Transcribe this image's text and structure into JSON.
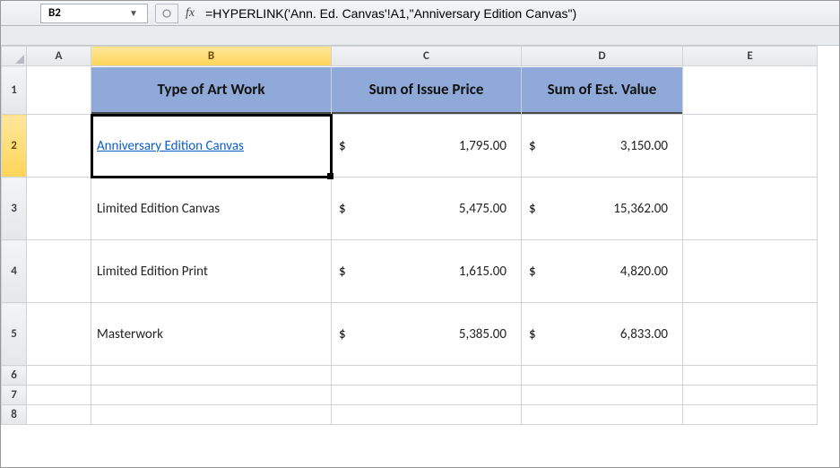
{
  "name_box": {
    "value": "B2"
  },
  "fx_label": "fx",
  "formula": "=HYPERLINK('Ann. Ed. Canvas'!A1,\"Anniversary Edition Canvas\")",
  "columns": [
    "A",
    "B",
    "C",
    "D",
    "E"
  ],
  "headers": {
    "B": "Type of Art Work",
    "C": "Sum of Issue Price",
    "D": "Sum of Est. Value"
  },
  "rows": [
    {
      "label": "Anniversary Edition Canvas",
      "link": true,
      "issue": "1,795.00",
      "est": "3,150.00"
    },
    {
      "label": "Limited Edition Canvas",
      "link": false,
      "issue": "5,475.00",
      "est": "15,362.00"
    },
    {
      "label": "Limited Edition Print",
      "link": false,
      "issue": "1,615.00",
      "est": "4,820.00"
    },
    {
      "label": "Masterwork",
      "link": false,
      "issue": "5,385.00",
      "est": "6,833.00"
    }
  ],
  "currency_symbol": "$",
  "active": {
    "ref": "B2",
    "col": "B",
    "row": 2
  }
}
